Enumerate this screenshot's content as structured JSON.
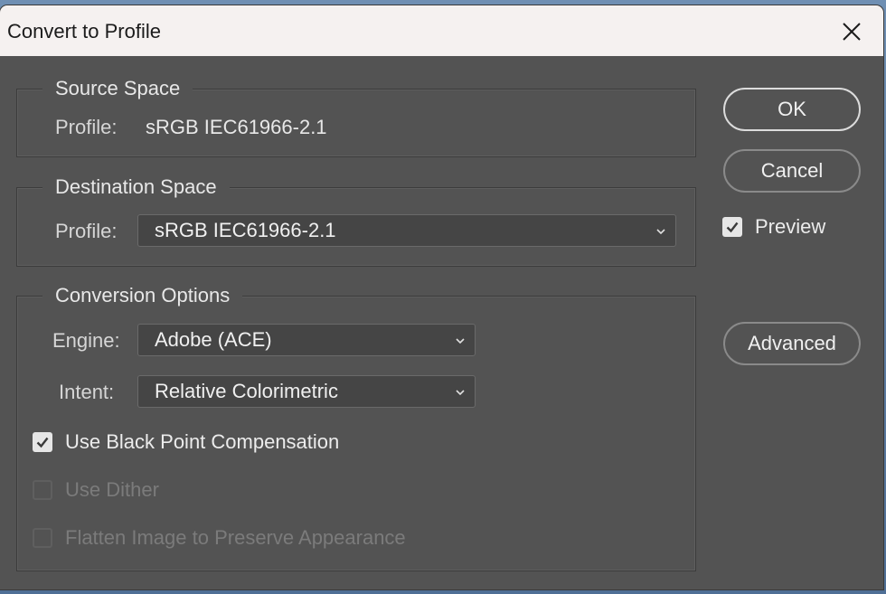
{
  "window": {
    "title": "Convert to Profile"
  },
  "source_space": {
    "legend": "Source Space",
    "profile_label": "Profile:",
    "profile_value": "sRGB IEC61966-2.1"
  },
  "destination_space": {
    "legend": "Destination Space",
    "profile_label": "Profile:",
    "profile_selected": "sRGB IEC61966-2.1"
  },
  "conversion_options": {
    "legend": "Conversion Options",
    "engine_label": "Engine:",
    "engine_selected": "Adobe (ACE)",
    "intent_label": "Intent:",
    "intent_selected": "Relative Colorimetric",
    "black_point": {
      "label": "Use Black Point Compensation",
      "checked": true,
      "enabled": true
    },
    "dither": {
      "label": "Use Dither",
      "checked": false,
      "enabled": false
    },
    "flatten": {
      "label": "Flatten Image to Preserve Appearance",
      "checked": false,
      "enabled": false
    }
  },
  "buttons": {
    "ok": "OK",
    "cancel": "Cancel",
    "advanced": "Advanced"
  },
  "preview": {
    "label": "Preview",
    "checked": true
  },
  "icons": {
    "close": "close-icon",
    "chevron": "chevron-down-icon",
    "check": "checkmark-icon"
  },
  "colors": {
    "dialog_bg": "#535353",
    "titlebar_bg": "#f5f1f0",
    "field_bg": "#454545",
    "text": "#e8e8e8",
    "disabled_text": "#7b7b7b"
  }
}
